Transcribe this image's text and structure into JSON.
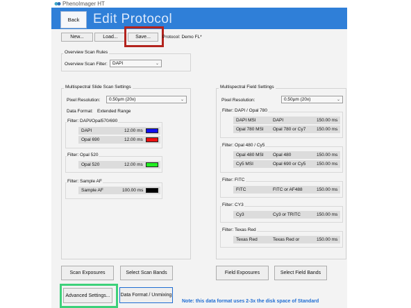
{
  "app": {
    "title": "PhenoImager HT"
  },
  "header": {
    "back_label": "Back",
    "page_title": "Edit Protocol"
  },
  "toolbar": {
    "new_label": "New...",
    "load_label": "Load...",
    "save_label": "Save...",
    "protocol_text": "Protocol: Demo FL*"
  },
  "overview": {
    "group_title": "Overview Scan Rules",
    "filter_label": "Overview Scan Filter:",
    "filter_value": "DAPI"
  },
  "slide": {
    "group_title": "Multispectral Slide Scan Settings",
    "pixel_label": "Pixel Resolution:",
    "pixel_value": "0.50µm (20x)",
    "format_label": "Data Format:",
    "format_value": "Extended Range",
    "filters": [
      {
        "title": "Filter: DAPI/Opal570/690",
        "rows": [
          {
            "name": "DAPI",
            "exposure": "12.00 ms",
            "color": "#1010ee"
          },
          {
            "name": "Opal 690",
            "exposure": "12.00 ms",
            "color": "#ee1010"
          }
        ]
      },
      {
        "title": "Filter: Opal 520",
        "rows": [
          {
            "name": "Opal 520",
            "exposure": "12.00 ms",
            "color": "#22ee22"
          }
        ]
      },
      {
        "title": "Filter: Sample AF",
        "rows": [
          {
            "name": "Sample AF",
            "exposure": "100.00 ms",
            "color": "#000000"
          }
        ]
      }
    ]
  },
  "field": {
    "group_title": "Multispectral Field Settings",
    "pixel_label": "Pixel Resolution:",
    "pixel_value": "0.50µm (20x)",
    "filters": [
      {
        "title": "Filter: DAPI / Opal 780",
        "rows": [
          {
            "name": "DAPI MSI",
            "band": "DAPI",
            "exposure": "150.00 ms"
          },
          {
            "name": "Opal 780 MSI",
            "band": "Opal 780 or Cy7",
            "exposure": "150.00 ms"
          }
        ]
      },
      {
        "title": "Filter: Opal 480 / Cy5",
        "rows": [
          {
            "name": "Opal 480 MSI",
            "band": "Opal 480",
            "exposure": "150.00 ms"
          },
          {
            "name": "Cy5 MSI",
            "band": "Opal 690 or Cy5",
            "exposure": "150.00 ms"
          }
        ]
      },
      {
        "title": "Filter: FITC",
        "rows": [
          {
            "name": "FITC",
            "band": "FITC or AF488",
            "exposure": "150.00 ms"
          }
        ]
      },
      {
        "title": "Filter: CY3",
        "rows": [
          {
            "name": "Cy3",
            "band": "Cy3 or TRITC",
            "exposure": "150.00 ms"
          }
        ]
      },
      {
        "title": "Filter: Texas Red",
        "rows": [
          {
            "name": "Texas Red",
            "band": "Texas Red or",
            "exposure": "150.00 ms"
          }
        ]
      }
    ]
  },
  "bottom": {
    "scan_exposures": "Scan Exposures",
    "select_scan_bands": "Select Scan Bands",
    "field_exposures": "Field Exposures",
    "select_field_bands": "Select Field Bands",
    "advanced_settings": "Advanced Settings...",
    "data_format": "Data Format / Unmixing",
    "note": "Note: this data format uses 2-3x the disk space of Standard"
  },
  "colors": {
    "header_blue": "#2f7fd8",
    "highlight_red": "#b3231d",
    "highlight_green": "#3dd17a",
    "note_blue": "#1e6cd3"
  }
}
